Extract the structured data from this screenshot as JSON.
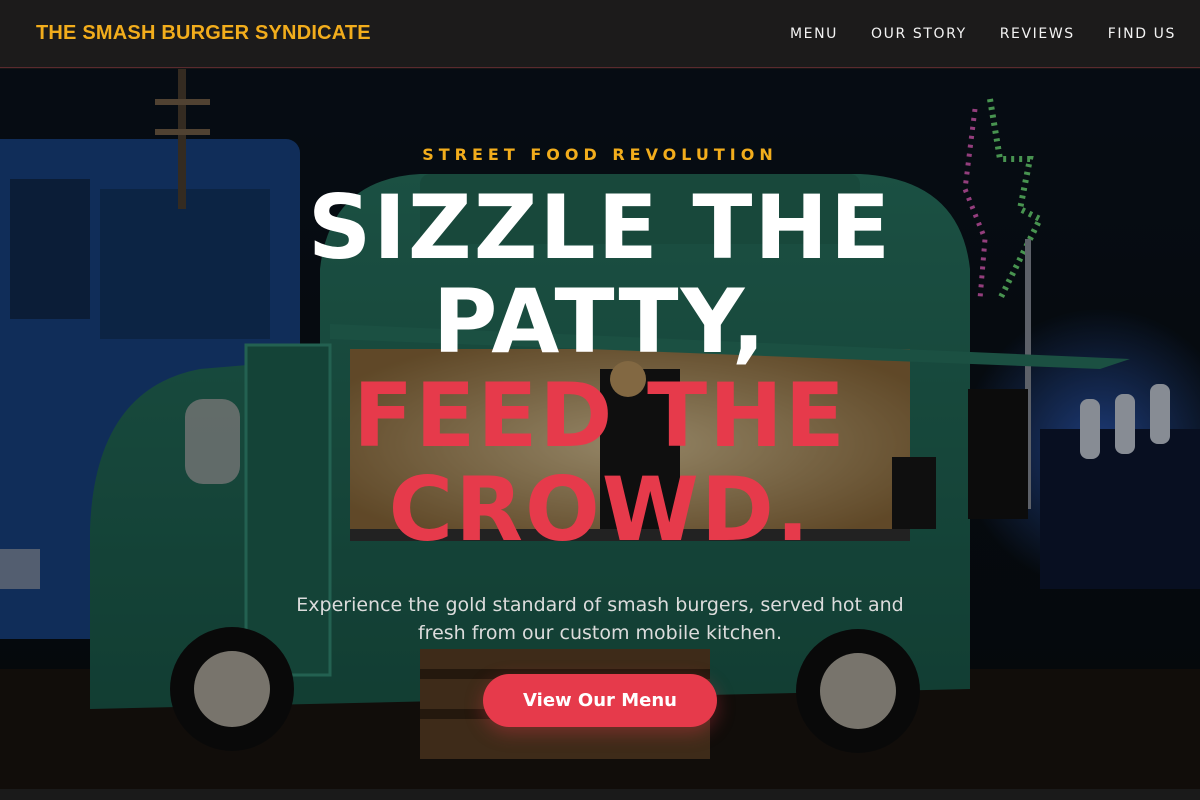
{
  "nav": {
    "brand": "THE SMASH BURGER SYNDICATE",
    "links": [
      "MENU",
      "OUR STORY",
      "REVIEWS",
      "FIND US"
    ]
  },
  "hero": {
    "eyebrow": "STREET FOOD REVOLUTION",
    "headline_line1": "SIZZLE THE PATTY,",
    "headline_line2": "FEED THE CROWD.",
    "subtitle": "Experience the gold standard of smash burgers, served hot and fresh from our custom mobile kitchen.",
    "cta_label": "View Our Menu"
  },
  "colors": {
    "accent_gold": "#f2ad1c",
    "accent_red": "#e63a4b",
    "nav_bg": "#1c1b1b"
  }
}
